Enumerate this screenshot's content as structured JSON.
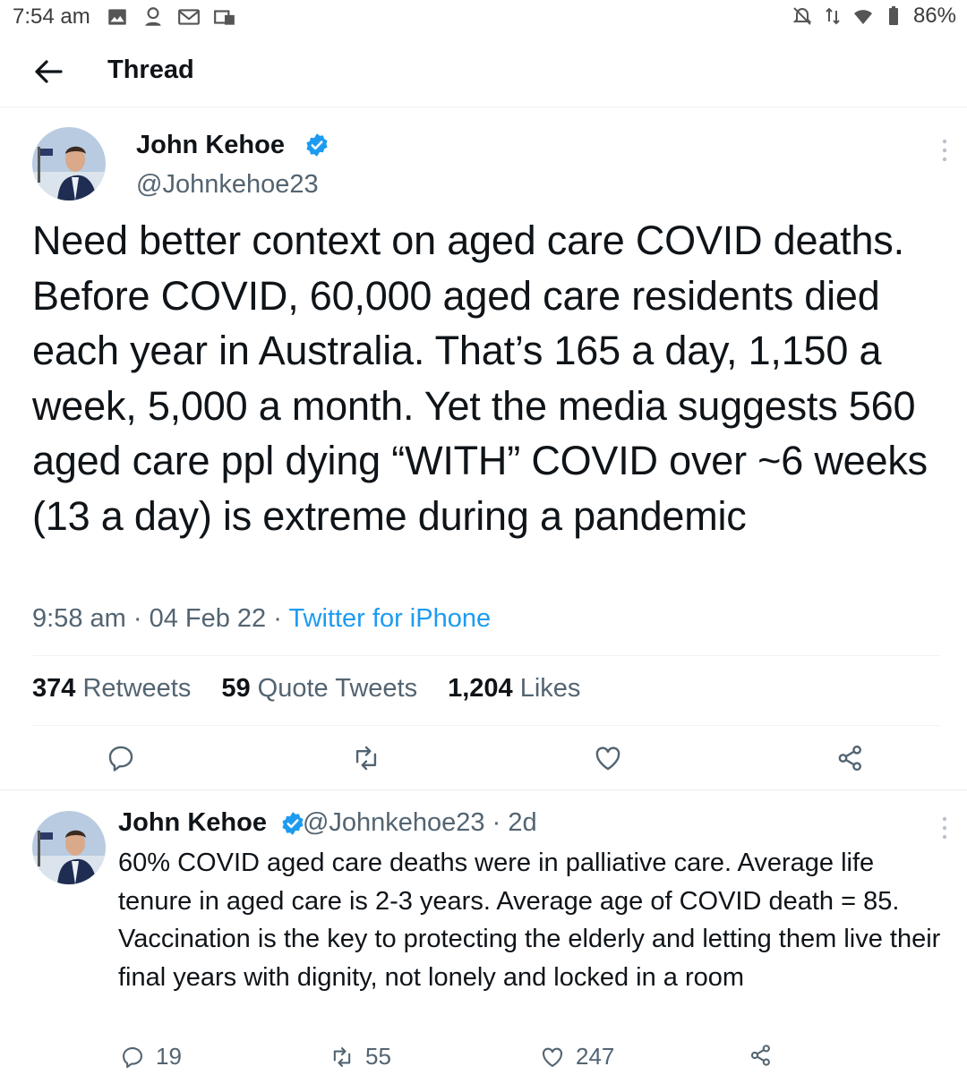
{
  "status_bar": {
    "time": "7:54 am",
    "battery": "86%",
    "notification_icons": [
      "gallery-icon",
      "incognito-icon",
      "gmail-icon",
      "photo-icon"
    ],
    "right_icons": [
      "mute-icon",
      "data-icon",
      "wifi-icon",
      "battery-icon"
    ]
  },
  "header": {
    "title": "Thread",
    "back_icon": "back-arrow-icon"
  },
  "main_tweet": {
    "author_name": "John Kehoe",
    "handle": "@Johnkehoe23",
    "verified": true,
    "text": "Need better context on aged care COVID deaths. Before COVID, 60,000 aged care residents died each year in Australia. That’s 165 a day, 1,150 a week, 5,000 a month. Yet the media suggests 560 aged care ppl dying “WITH” COVID over ~6 weeks (13 a day) is extreme during a pandemic",
    "time": "9:58 am",
    "date": "04 Feb 22",
    "source": "Twitter for iPhone",
    "meta_separator": " · ",
    "stats": {
      "retweets_count": "374",
      "retweets_label": "Retweets",
      "quotes_count": "59",
      "quotes_label": "Quote Tweets",
      "likes_count": "1,204",
      "likes_label": "Likes"
    }
  },
  "reply_tweet": {
    "author_name": "John Kehoe",
    "handle_time": "@Johnkehoe23 · 2d",
    "verified": true,
    "text": "60% COVID aged care deaths were in palliative care. Average life tenure in aged care is 2-3 years. Average age of COVID death = 85. Vaccination is the key to protecting the elderly and letting them live their final years with dignity, not lonely and locked in a room",
    "replies": "19",
    "retweets": "55",
    "likes": "247"
  },
  "colors": {
    "text_primary": "#0f1419",
    "text_secondary": "#536471",
    "accent": "#1d9bf0",
    "divider": "#eff3f4"
  }
}
